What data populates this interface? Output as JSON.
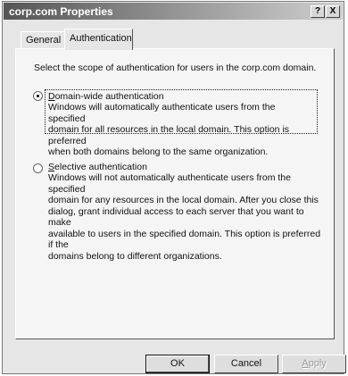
{
  "window": {
    "title": "corp.com Properties",
    "help_button": "?",
    "close_button": "X"
  },
  "tabs": [
    {
      "label": "General",
      "selected": false
    },
    {
      "label": "Authentication",
      "selected": true
    }
  ],
  "panel": {
    "scope_text": "Select the scope of authentication for users in the corp.com domain.",
    "options": [
      {
        "label_mnemonic": "D",
        "label_rest": "omain-wide authentication",
        "selected": true,
        "description_lines": [
          "Windows will automatically authenticate users from the specified",
          "domain for all resources in the local domain. This option is preferred",
          "when both domains belong to the same organization."
        ]
      },
      {
        "label_mnemonic": "S",
        "label_rest": "elective authentication",
        "selected": false,
        "description_lines": [
          "Windows will not automatically authenticate users from the specified",
          "domain for any resources in the local domain. After you close this",
          "dialog, grant individual access to each server that you want to make",
          "available to users in the specified domain. This option is preferred if the",
          "domains belong to different organizations."
        ]
      }
    ]
  },
  "buttons": {
    "ok": "OK",
    "cancel": "Cancel",
    "apply_mnemonic": "A",
    "apply_rest": "pply"
  }
}
